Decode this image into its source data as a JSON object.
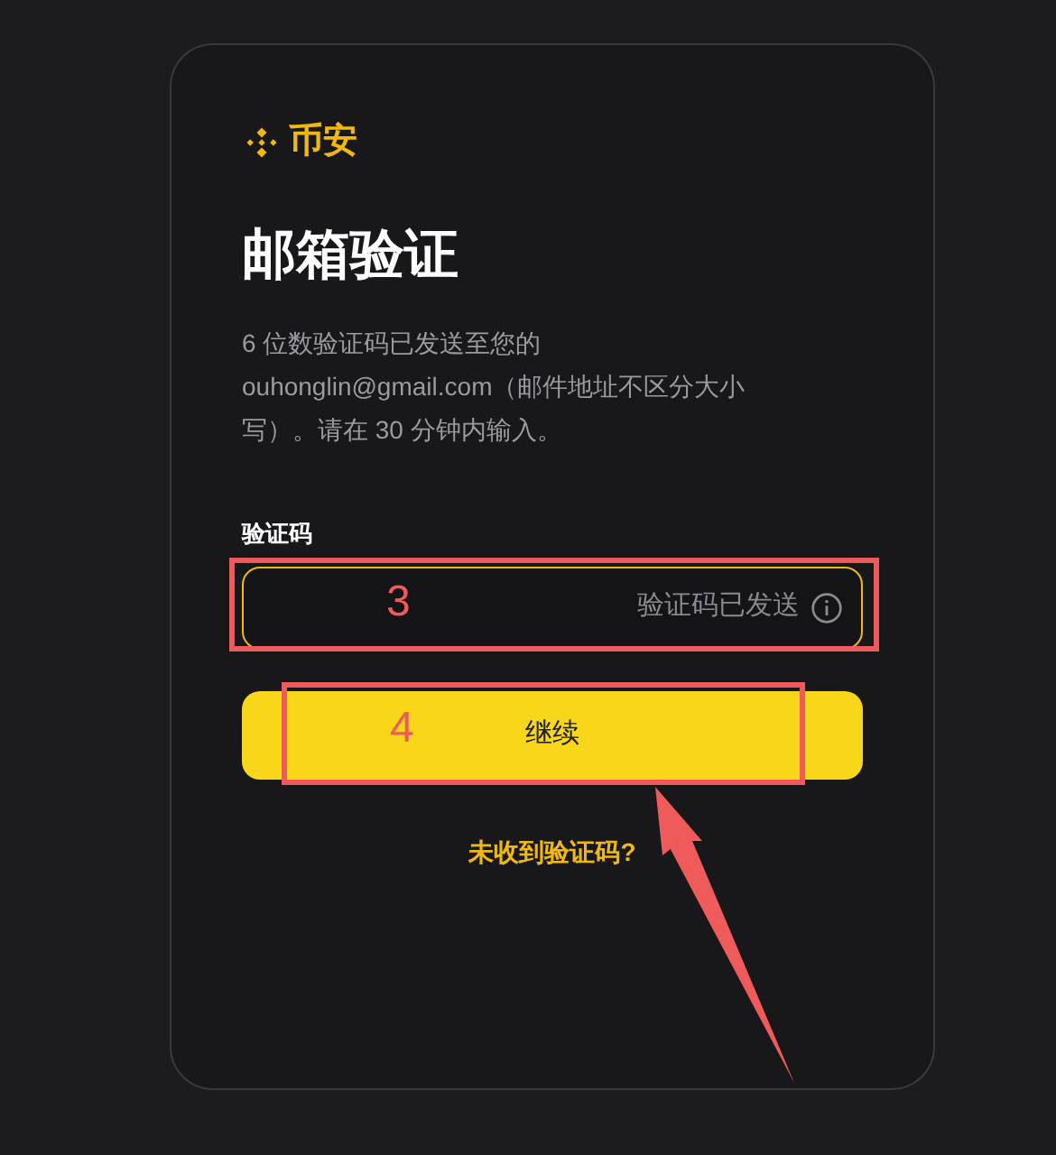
{
  "brand": {
    "name": "币安"
  },
  "title": "邮箱验证",
  "description": "6 位数验证码已发送至您的 ouhonglin@gmail.com（邮件地址不区分大小写）。请在 30 分钟内输入。",
  "code_field": {
    "label": "验证码",
    "status": "验证码已发送",
    "focused": true
  },
  "continue_button": {
    "label": "继续"
  },
  "resend_link": {
    "label": "未收到验证码?"
  },
  "annotations": [
    {
      "kind": "box",
      "label": "3"
    },
    {
      "kind": "box",
      "label": "4"
    },
    {
      "kind": "arrow"
    }
  ]
}
